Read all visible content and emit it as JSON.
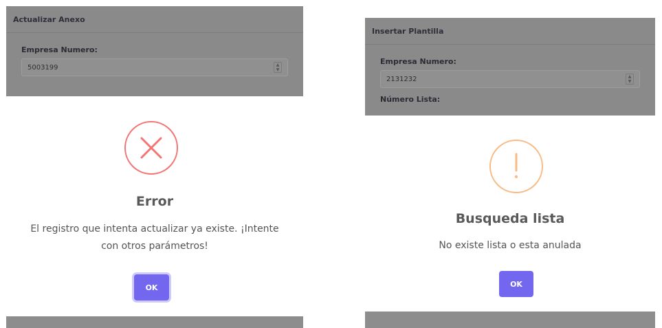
{
  "left": {
    "header_title": "Actualizar Anexo",
    "field_label": "Empresa Numero:",
    "field_value": "5003199",
    "dialog": {
      "icon": "error-x-icon",
      "title": "Error",
      "message_line1": "El registro que intenta actualizar ya existe. ¡Intente",
      "message_line2": "con otros parámetros!",
      "ok_label": "OK"
    }
  },
  "right": {
    "header_title": "Insertar Plantilla",
    "field_label": "Empresa Numero:",
    "field_value": "2131232",
    "field2_label": "Número Lista:",
    "dialog": {
      "icon": "warning-exclamation-icon",
      "title": "Busqueda lista",
      "message": "No existe lista o esta anulada",
      "ok_label": "OK"
    }
  },
  "colors": {
    "error": "#f27474",
    "warning": "#f8bb86",
    "button": "#7367f0"
  }
}
